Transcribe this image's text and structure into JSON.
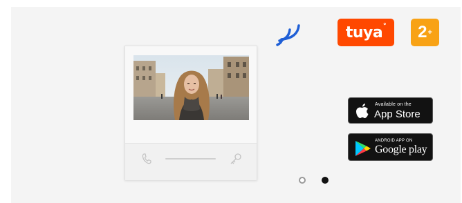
{
  "carousel": {
    "device": {
      "screen_image": "woman-in-town-square-photo",
      "handset_icon": "handset-icon",
      "key_icon": "key-icon"
    },
    "wifi_icon": "wifi-icon",
    "colors": {
      "wifi": "#1f5fd6",
      "tuya": "#ff4800",
      "zplus": "#f8a215",
      "store_bg": "#121212",
      "panel_bg": "#f4f4f4"
    },
    "tuya_badge": {
      "text": "tuya",
      "mark": "°"
    },
    "zplus_badge": {
      "text": "2",
      "mark": "+"
    },
    "app_store": {
      "icon": "apple-icon",
      "small_text": "Available on the",
      "big_text": "App Store"
    },
    "google_play": {
      "icon": "google-play-icon",
      "small_text": "ANDROID APP ON",
      "big_text": "Google play"
    },
    "pagination": {
      "active_index": 2,
      "count": 2
    }
  }
}
